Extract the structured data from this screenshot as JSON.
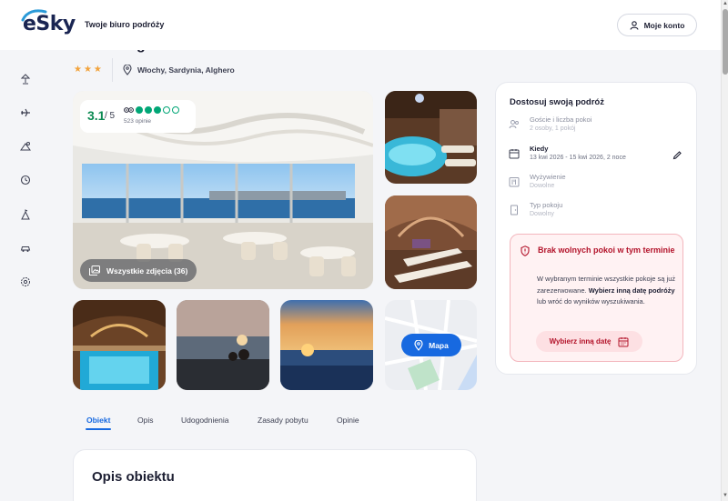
{
  "header": {
    "brand": "eSky",
    "tagline": "Twoje biuro podróży",
    "account_label": "Moje konto"
  },
  "rail": {
    "icons": [
      "beach-umbrella-icon",
      "plane-icon",
      "hotel-deal-icon",
      "last-minute-clock-icon",
      "camping-icon",
      "car-icon",
      "settings-gear-icon"
    ]
  },
  "hotel": {
    "title_fragment": "g",
    "stars": "★★★",
    "star_count": 3,
    "location": "Włochy, Sardynia, Alghero"
  },
  "rating": {
    "score": "3.1",
    "out_of": "/ 5",
    "filled_dots": 3,
    "total_dots": 5,
    "reviews": "523 opinie"
  },
  "gallery": {
    "all_photos_label": "Wszystkie zdjęcia (36)",
    "map_label": "Mapa"
  },
  "tabs": [
    {
      "label": "Obiekt",
      "active": true
    },
    {
      "label": "Opis",
      "active": false
    },
    {
      "label": "Udogodnienia",
      "active": false
    },
    {
      "label": "Zasady pobytu",
      "active": false
    },
    {
      "label": "Opinie",
      "active": false
    }
  ],
  "description": {
    "title": "Opis obiektu"
  },
  "panel": {
    "title": "Dostosuj swoją podróż",
    "rows": [
      {
        "label": "Goście i liczba pokoi",
        "value": "2 osoby, 1 pokój"
      },
      {
        "label": "Kiedy",
        "value": "13 kwi 2026 - 15 kwi 2026, 2 noce"
      },
      {
        "label": "Wyżywienie",
        "value": "Dowolne"
      },
      {
        "label": "Typ pokoju",
        "value": "Dowolny"
      }
    ],
    "alert": {
      "title": "Brak wolnych pokoi w tym terminie",
      "text_1": "W wybranym terminie wszystkie pokoje są już zarezerwowane.",
      "text_bold": "Wybierz inną datę podróży",
      "text_2": "lub wróć do wyników wyszukiwania.",
      "button": "Wybierz inną datę"
    }
  },
  "colors": {
    "brand_navy": "#1a2552",
    "accent_blue": "#1769e0",
    "rating_green": "#00a676",
    "alert_red": "#b3132a",
    "star_orange": "#f2a33c"
  }
}
